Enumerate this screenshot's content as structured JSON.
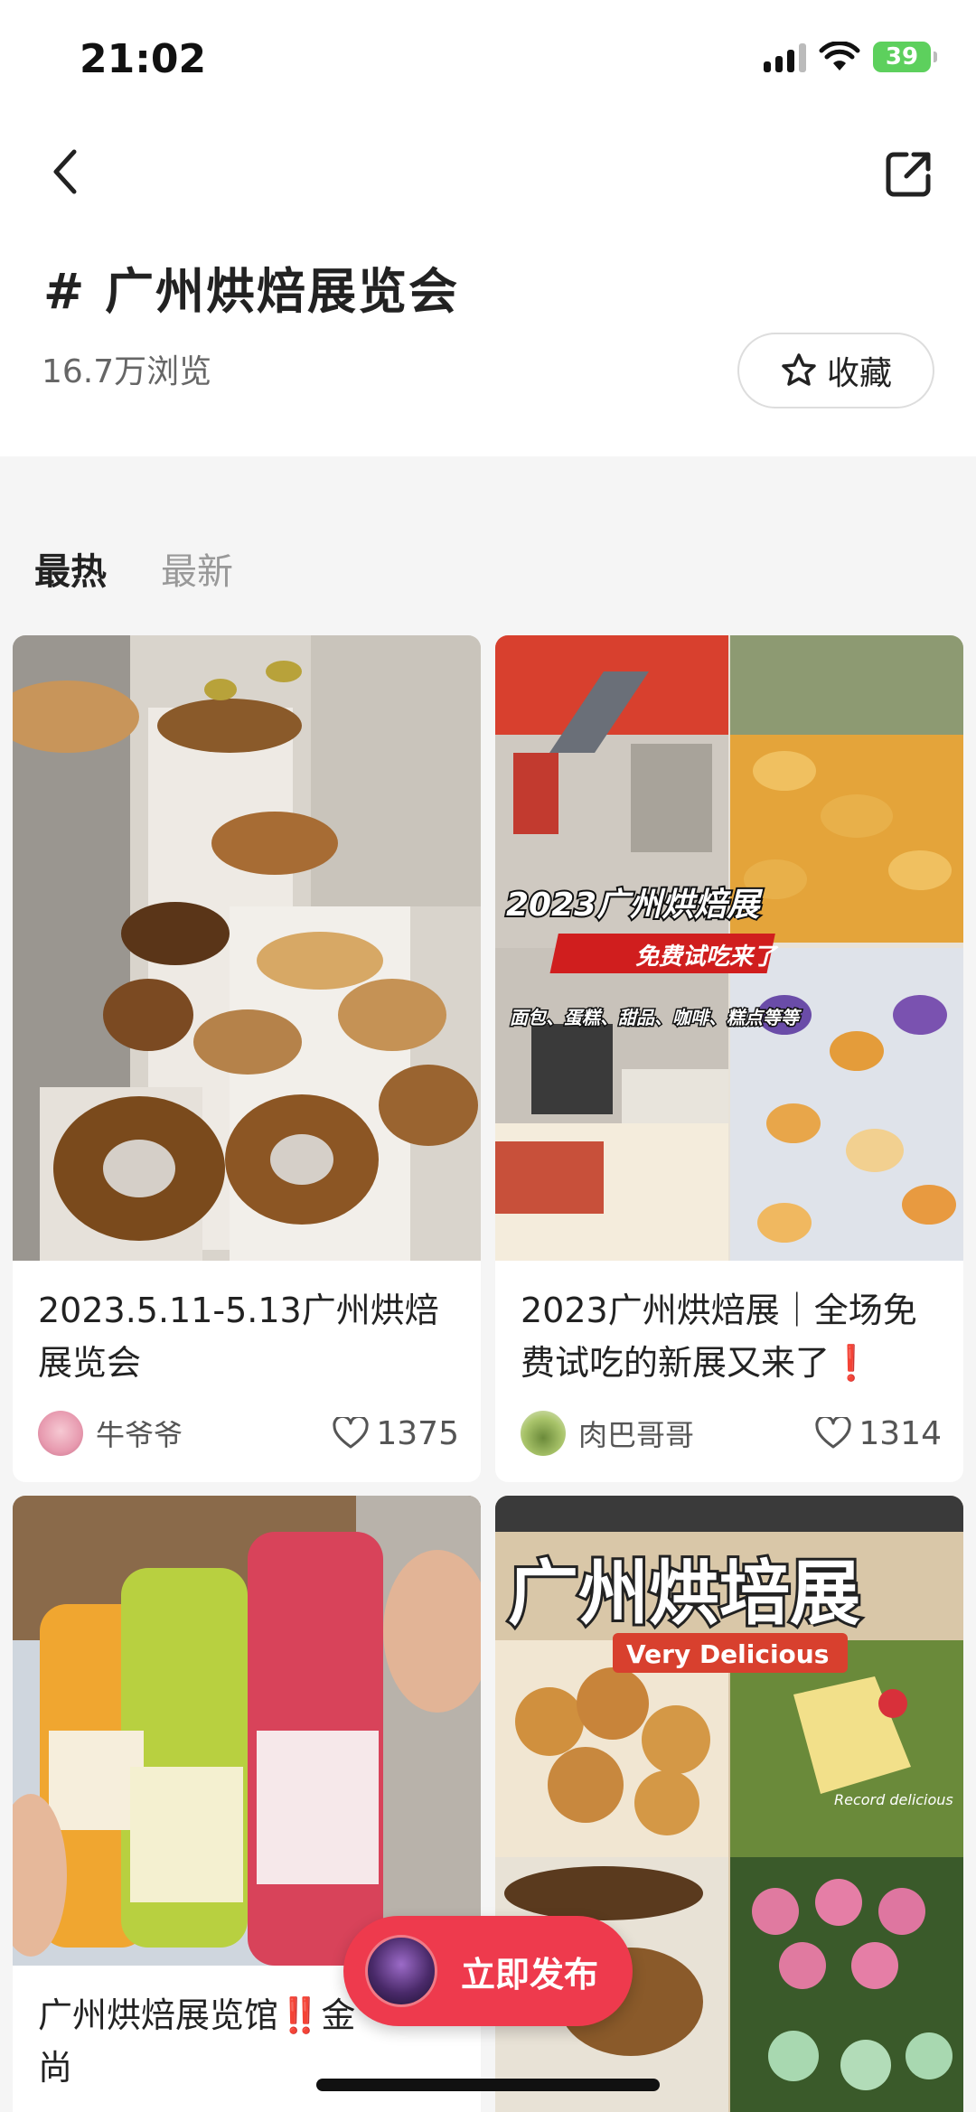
{
  "status_bar": {
    "time": "21:02",
    "battery": "39"
  },
  "header": {
    "topic_title": "# 广州烘焙展览会",
    "views": "16.7万浏览",
    "collect_label": "收藏"
  },
  "tabs": [
    {
      "label": "最热",
      "active": true
    },
    {
      "label": "最新",
      "active": false
    }
  ],
  "image_texts": {
    "post2_headline": "2023广州烘焙展",
    "post2_sub": "免费试吃来了",
    "post2_items": "面包、蛋糕、甜品、咖啡、糕点等等",
    "post4_headline": "广州烘培展",
    "post4_sub": "Very Delicious",
    "post4_caption": "Record delicious"
  },
  "feed": [
    {
      "title": "2023.5.11-5.13广州烘焙展览会",
      "author": "牛爷爷",
      "likes": "1375"
    },
    {
      "title": "2023广州烘焙展｜全场免费试吃的新展又来了",
      "title_mark": "❗",
      "author": "肉巴哥哥",
      "likes": "1314"
    },
    {
      "title_a": "广州烘焙展览馆",
      "title_mark": "‼️",
      "title_b": "金",
      "title_cut": "尚"
    }
  ],
  "publish": {
    "label": "立即发布"
  },
  "colors": {
    "accent": "#ee3a4d",
    "battery": "#5dd05d"
  }
}
